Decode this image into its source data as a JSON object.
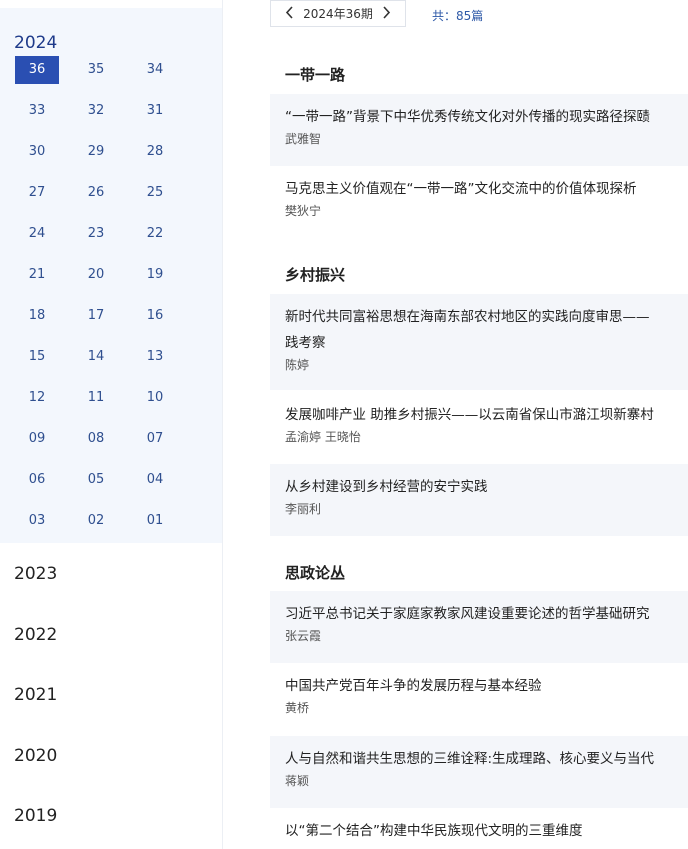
{
  "sidebar": {
    "current_year": "2024",
    "issues": [
      {
        "num": "36",
        "active": true
      },
      {
        "num": "35"
      },
      {
        "num": "34"
      },
      {
        "num": "33"
      },
      {
        "num": "32"
      },
      {
        "num": "31"
      },
      {
        "num": "30"
      },
      {
        "num": "29"
      },
      {
        "num": "28"
      },
      {
        "num": "27"
      },
      {
        "num": "26"
      },
      {
        "num": "25"
      },
      {
        "num": "24"
      },
      {
        "num": "23"
      },
      {
        "num": "22"
      },
      {
        "num": "21"
      },
      {
        "num": "20"
      },
      {
        "num": "19"
      },
      {
        "num": "18"
      },
      {
        "num": "17"
      },
      {
        "num": "16"
      },
      {
        "num": "15"
      },
      {
        "num": "14"
      },
      {
        "num": "13"
      },
      {
        "num": "12"
      },
      {
        "num": "11"
      },
      {
        "num": "10"
      },
      {
        "num": "09"
      },
      {
        "num": "08"
      },
      {
        "num": "07"
      },
      {
        "num": "06"
      },
      {
        "num": "05"
      },
      {
        "num": "04"
      },
      {
        "num": "03"
      },
      {
        "num": "02"
      },
      {
        "num": "01"
      }
    ],
    "other_years": [
      "2023",
      "2022",
      "2021",
      "2020",
      "2019"
    ]
  },
  "pager": {
    "prev_icon": "chevron-left-icon",
    "next_icon": "chevron-right-icon",
    "issue_label": "2024年36期"
  },
  "total": {
    "label": "共：",
    "count": "85篇"
  },
  "colors": {
    "accent": "#2a4fb2",
    "link": "#2f5aa8",
    "panel": "#f3f7fd"
  },
  "sections": [
    {
      "title": "一带一路",
      "articles": [
        {
          "title": "“一带一路”背景下中华优秀传统文化对外传播的现实路径探赜",
          "authors": "武雅智"
        },
        {
          "title": "马克思主义价值观在“一带一路”文化交流中的价值体现探析",
          "authors": "樊狄宁"
        }
      ]
    },
    {
      "title": "乡村振兴",
      "articles": [
        {
          "title": "新时代共同富裕思想在海南东部农村地区的实践向度审思——",
          "title_cont": "践考察",
          "authors": "陈婷"
        },
        {
          "title": "发展咖啡产业 助推乡村振兴——以云南省保山市潞江坝新寨村",
          "authors": "孟渝婷 王晓怡"
        },
        {
          "title": "从乡村建设到乡村经营的安宁实践",
          "authors": "李丽利"
        }
      ]
    },
    {
      "title": "思政论丛",
      "articles": [
        {
          "title": "习近平总书记关于家庭家教家风建设重要论述的哲学基础研究",
          "authors": "张云霞"
        },
        {
          "title": "中国共产党百年斗争的发展历程与基本经验",
          "authors": "黄桥"
        },
        {
          "title": "人与自然和谐共生思想的三维诠释:生成理路、核心要义与当代",
          "authors": "蒋颖"
        },
        {
          "title": "以“第二个结合”构建中华民族现代文明的三重维度",
          "authors": ""
        }
      ]
    }
  ]
}
